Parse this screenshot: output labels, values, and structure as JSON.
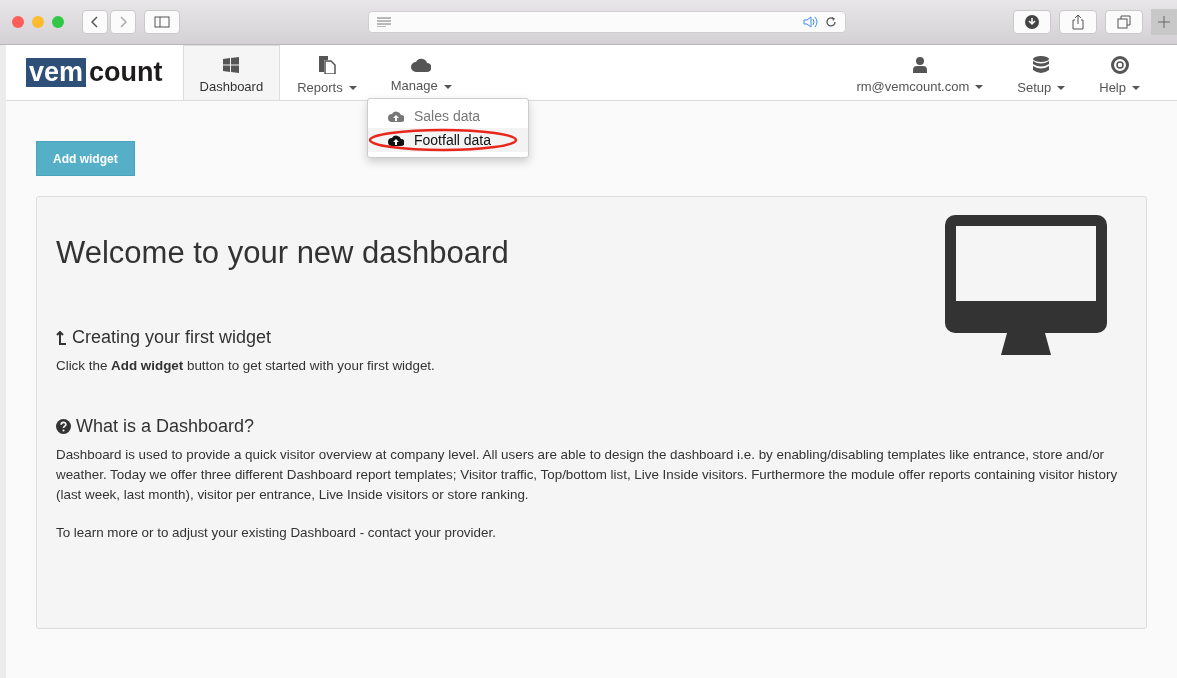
{
  "logo": {
    "part_1": "vem",
    "part_2": "count"
  },
  "nav_left": [
    {
      "label": "Dashboard",
      "kind": "windows",
      "caret": false,
      "selected": true
    },
    {
      "label": "Reports",
      "kind": "files",
      "caret": true,
      "selected": false
    },
    {
      "label": "Manage",
      "kind": "cloud",
      "caret": true,
      "selected": false
    }
  ],
  "nav_right": [
    {
      "label": "rm@vemcount.com",
      "kind": "user",
      "caret": true,
      "selected": false
    },
    {
      "label": "Setup",
      "kind": "database",
      "caret": true,
      "selected": false
    },
    {
      "label": "Help",
      "kind": "lifebuoy",
      "caret": true,
      "selected": false
    }
  ],
  "manage_menu": [
    {
      "label": "Sales data",
      "selected": false,
      "circled": false
    },
    {
      "label": "Footfall data",
      "selected": true,
      "circled": true
    }
  ],
  "add_widget_button": "Add widget",
  "panel": {
    "title": "Welcome to your new dashboard",
    "sections": [
      {
        "kind": "arrow-up",
        "heading": "Creating your first widget",
        "paragraphs": [
          "Click the **Add widget** button to get started with your first widget."
        ]
      },
      {
        "kind": "question",
        "heading": "What is a Dashboard?",
        "paragraphs": [
          "Dashboard is used to provide a quick visitor overview at company level. All users are able to design the dashboard i.e. by enabling/disabling templates like entrance, store and/or weather. Today we offer three different Dashboard report templates; Visitor traffic, Top/bottom list, Live Inside visitors. Furthermore the module offer reports containing visitor history (last week, last month), visitor per entrance, Live Inside visitors or store ranking.",
          "To learn more or to adjust your existing Dashboard - contact your provider."
        ]
      }
    ]
  }
}
